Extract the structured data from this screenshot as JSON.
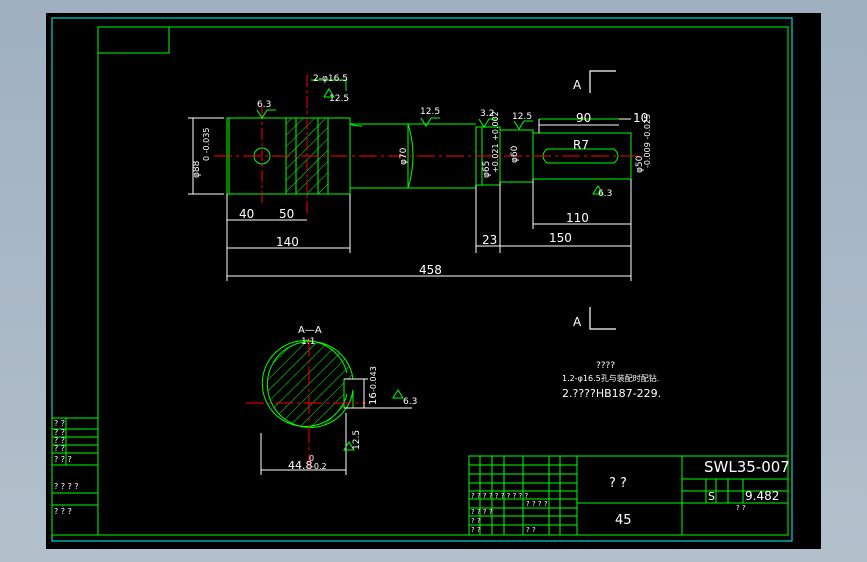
{
  "drawing": {
    "part_number": "SWL35-007",
    "part_name": "? ?",
    "material": "45",
    "scale_label": "S",
    "weight": "9.482",
    "title_cells": [
      "? ? ? ?",
      "? ?",
      "? ?",
      "? ?"
    ],
    "left_block_labels": [
      "? ?",
      "? ?",
      "? ?",
      "? ?",
      "? ? ?",
      "? ? ? ?",
      "? ? ?"
    ],
    "title_small_labels": [
      "? ? ? ? ? ? ? ? ? ?",
      "? ? ? ?",
      "? ?"
    ]
  },
  "section": {
    "name": "A",
    "title": "A—A",
    "scale": "1:1",
    "dim_width": "44.8",
    "dim_tol_lower": "0",
    "dim_tol_upper": "-0.2",
    "dim_key": "16",
    "dim_key_tol": "-0.043",
    "roughness_a": "6.3",
    "roughness_b": "12.5"
  },
  "shaft": {
    "total_length": "458",
    "dims": {
      "d140": "140",
      "d40": "40",
      "d50": "50",
      "d23": "23",
      "d150": "150",
      "d110": "110",
      "d90": "90",
      "d10": "10"
    },
    "diameters": {
      "main": "φ88",
      "main_tol": "0 -0.035",
      "mid": "φ70",
      "bearing": "φ65",
      "bearing_tol": "+0.021 +0.002",
      "step": "φ60",
      "end": "φ50",
      "end_tol": "-0.009 -0.025"
    },
    "holes": "2-φ16.5",
    "radius": "R7",
    "roughness": [
      "6.3",
      "12.5",
      "12.5",
      "3.2",
      "12.5",
      "6.3"
    ]
  },
  "notes": {
    "heading": "????",
    "line1": "1.2-φ16.5孔与装配时配钻.",
    "line2": "2.????HB187-229."
  },
  "colors": {
    "frame": "#00ffff",
    "outline": "#00ff00",
    "center": "#ff0000",
    "dimension": "#ffffff"
  }
}
